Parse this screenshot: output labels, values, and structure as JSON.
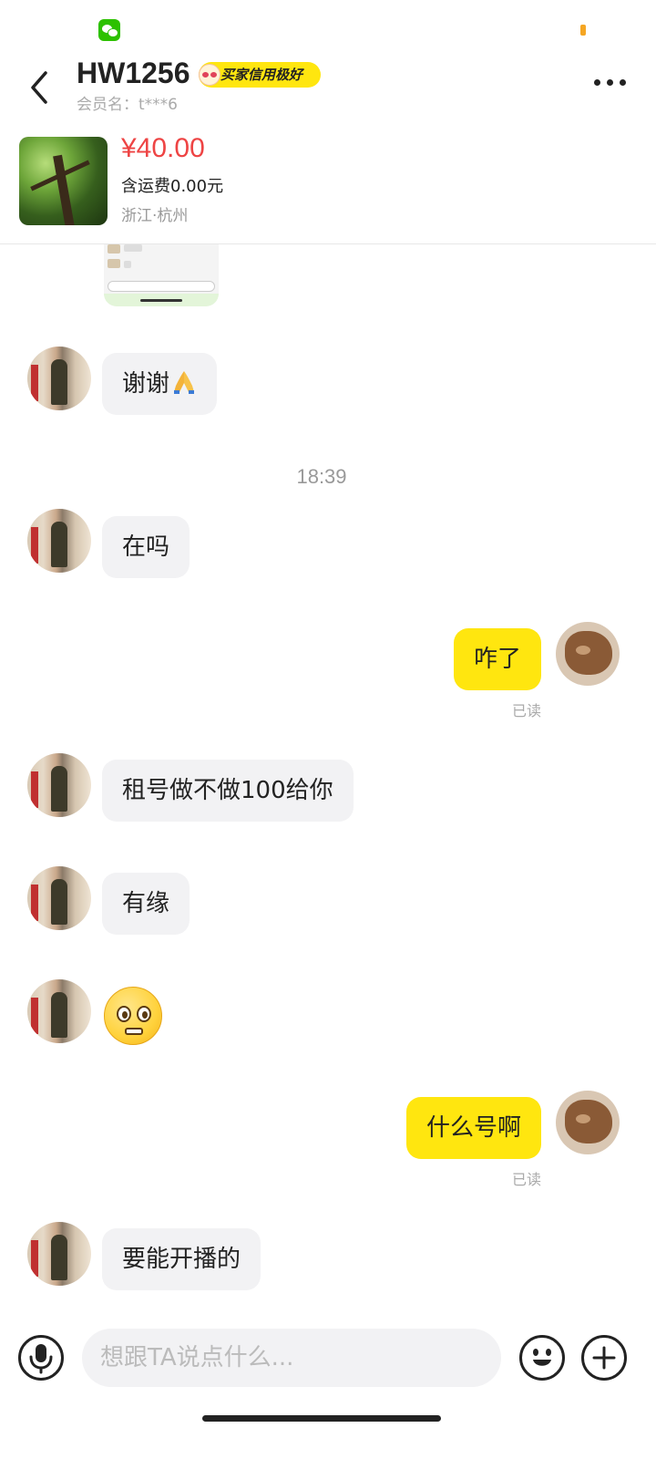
{
  "header": {
    "title": "HW1256",
    "badge": "买家信用极好",
    "member_label": "会员名：t***6"
  },
  "product": {
    "price": "¥40.00",
    "shipping": "含运费0.00元",
    "location": "浙江·杭州"
  },
  "messages": [
    {
      "from": "them",
      "type": "text",
      "text": "谢谢",
      "emoji": "pray-emoji"
    },
    {
      "type": "time",
      "text": "18:39"
    },
    {
      "from": "them",
      "type": "text",
      "text": "在吗"
    },
    {
      "from": "me",
      "type": "text",
      "text": "咋了",
      "status": "已读"
    },
    {
      "from": "them",
      "type": "text",
      "text": "租号做不做100给你"
    },
    {
      "from": "them",
      "type": "text",
      "text": "有缘"
    },
    {
      "from": "them",
      "type": "emoji",
      "emoji": "flushed-face-emoji"
    },
    {
      "from": "me",
      "type": "text",
      "text": "什么号啊",
      "status": "已读"
    },
    {
      "from": "them",
      "type": "text",
      "text": "要能开播的"
    }
  ],
  "input": {
    "placeholder": "想跟TA说点什么..."
  },
  "icons": {
    "back": "chevron-left-icon",
    "more": "more-dots-icon",
    "voice": "microphone-icon",
    "emoji": "smiley-icon",
    "plus": "plus-icon",
    "status_app": "wechat-icon"
  },
  "colors": {
    "my_bubble": "#ffe60f",
    "their_bubble": "#f2f2f4",
    "price": "#ee4444",
    "badge": "#ffe60f"
  }
}
